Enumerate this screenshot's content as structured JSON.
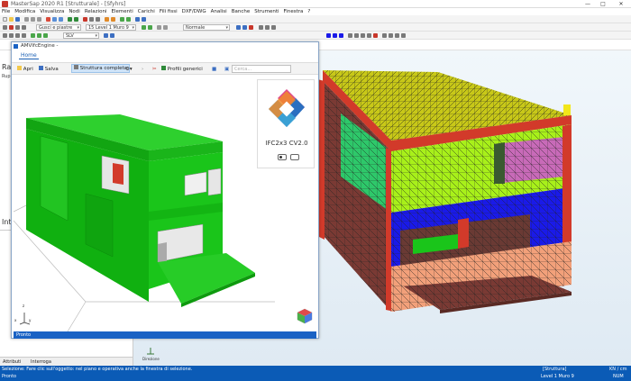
{
  "app": {
    "title": "MasterSap 2020 R1 [Strutturale] - [Sfyhrs]"
  },
  "window": {
    "minimize": "—",
    "maximize": "□",
    "close": "✕"
  },
  "menu": [
    "File",
    "Modifica",
    "Visualizza",
    "Nodi",
    "Relazioni",
    "Elementi",
    "Carichi",
    "Fili fissi",
    "DXF/DWG",
    "Analisi",
    "Banche",
    "Strumenti",
    "Finestra",
    "?"
  ],
  "toolbar": {
    "filter": "Gusci e piastre",
    "level": "15 Level 1 Muro 9",
    "view_mode": "Normale",
    "unit": "SLV"
  },
  "left_panel": {
    "title": "Rap",
    "subtitle": "Ruppeo",
    "section": "Inte",
    "tabs": [
      "Attributi",
      "Interroga"
    ]
  },
  "dialog": {
    "title": "AMVIfcEngine -",
    "tab": "Home",
    "ribbon": {
      "open": "Apri",
      "save": "Salva",
      "struttura": "Struttura completa",
      "profili": "Profili generici",
      "search_placeholder": "Cerca..."
    },
    "ifc_label": "IFC2x3 CV2.0",
    "axis": {
      "x": "x",
      "y": "y",
      "z": "z"
    },
    "status": "Pronto"
  },
  "viewport": {
    "axis_label": "Direzione"
  },
  "status": {
    "message": "Selezione: Fare clic sull'oggetto: nel piano e operativa anche la finestra di selezione.",
    "ready": "Pronto",
    "mode": "[Struttura]",
    "level": "Level 1 Muro 9",
    "units": "KN / cm",
    "brand": "NUM"
  },
  "colors": {
    "accent": "#0b5bb6",
    "model_green": "#1ac51a",
    "floor_yellow": "#c8c818",
    "mesh_lime": "#a8f01a",
    "mesh_blue": "#1a1ae8",
    "mesh_red": "#d23a2a",
    "mesh_maroon": "#7a3a34",
    "mesh_salmon": "#f2a07a"
  }
}
